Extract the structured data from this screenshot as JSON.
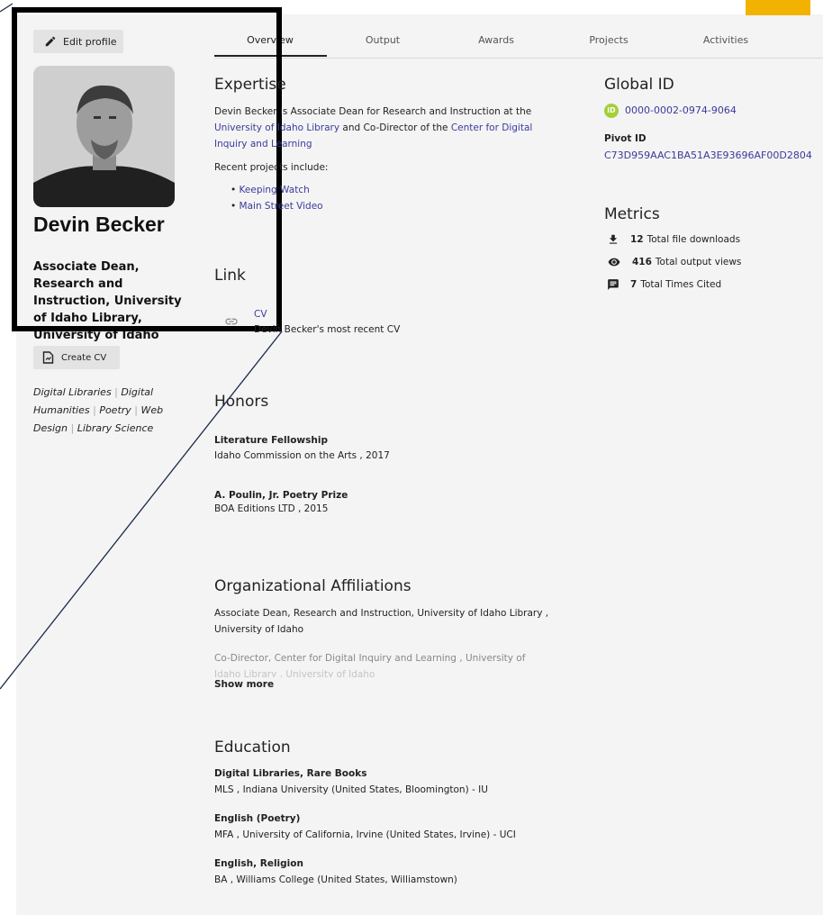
{
  "colors": {
    "accent": "#f1b300",
    "link": "#3b3a9c",
    "orcid": "#a6ce39",
    "highlight": "#000000"
  },
  "tabs": [
    {
      "label": "Overview"
    },
    {
      "label": "Output"
    },
    {
      "label": "Awards"
    },
    {
      "label": "Projects"
    },
    {
      "label": "Activities"
    }
  ],
  "profile": {
    "edit_label": "Edit profile",
    "name": "Devin Becker",
    "role": "Associate Dean, Research and Instruction, University of Idaho Library, University of Idaho",
    "create_cv_label": "Create CV",
    "keywords": [
      "Digital Libraries",
      "Digital Humanities",
      "Poetry",
      "Web Design",
      "Library Science"
    ]
  },
  "expertise": {
    "title": "Expertise",
    "intro_1": "Devin Becker is Associate Dean for Research and Instruction at the",
    "link_1": "University of Idaho Library",
    "intro_2": " and Co-Director of the ",
    "link_2": "Center for Digital",
    "link_2b": "Inquiry and Learning",
    "recent": "Recent projects include:",
    "projects": [
      "Keeping Watch",
      "Main Street Video"
    ]
  },
  "link_section": {
    "title": "Link",
    "items": [
      {
        "title": "CV",
        "description": "Devin Becker's most recent CV"
      }
    ]
  },
  "honors": {
    "title": "Honors",
    "items": [
      {
        "title": "Literature Fellowship",
        "detail": "Idaho Commission on the Arts , 2017"
      },
      {
        "title": "A. Poulin, Jr. Poetry Prize",
        "detail": "BOA Editions LTD , 2015"
      }
    ]
  },
  "affiliations": {
    "title": "Organizational Affiliations",
    "item_1_line_1": "Associate Dean, Research and Instruction, University of Idaho Library ,",
    "item_1_line_2": "University of Idaho",
    "item_2_line_1": "Co-Director, Center for Digital Inquiry and Learning , University of",
    "item_2_line_2": "Idaho Library , University of Idaho",
    "show_more": "Show more"
  },
  "education": {
    "title": "Education",
    "items": [
      {
        "title": "Digital Libraries, Rare Books",
        "detail": "MLS , Indiana University (United States, Bloomington) - IU"
      },
      {
        "title": "English (Poetry)",
        "detail": "MFA , University of California, Irvine (United States, Irvine) - UCI"
      },
      {
        "title": "English, Religion",
        "detail": "BA , Williams College (United States, Williamstown)"
      }
    ]
  },
  "global_id": {
    "title": "Global ID",
    "orcid_badge": "iD",
    "orcid": "0000-0002-0974-9064",
    "pivot_label": "Pivot ID",
    "pivot": "C73D959AAC1BA51A3E93696AF00D2804"
  },
  "metrics": {
    "title": "Metrics",
    "items": [
      {
        "icon": "download-icon",
        "value": "12",
        "label": "Total file downloads"
      },
      {
        "icon": "eye-icon",
        "value": "416",
        "label": "Total output views"
      },
      {
        "icon": "comment-icon",
        "value": "7",
        "label": "Total Times Cited"
      }
    ]
  }
}
